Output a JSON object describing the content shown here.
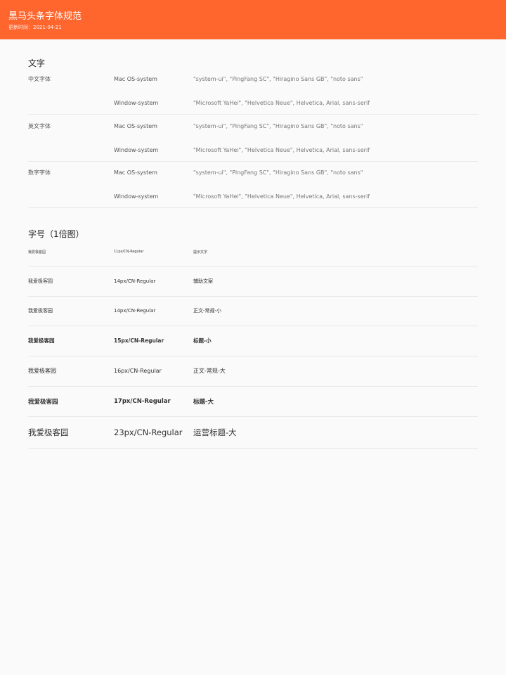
{
  "header": {
    "title": "黑马头条字体规范",
    "updated": "更新时间：2021-04-21"
  },
  "fonts_section": {
    "title": "文字",
    "groups": [
      {
        "label": "中文字体",
        "rows": [
          {
            "system": "Mac OS-system",
            "stack": "\"system-ui\", \"PingFang SC\", \"Hiragino Sans GB\", \"noto sans\""
          },
          {
            "system": "Window-system",
            "stack": "\"Microsoft YaHei\", \"Helvetica Neue\", Helvetica, Arial, sans-serif"
          }
        ]
      },
      {
        "label": "英文字体",
        "rows": [
          {
            "system": "Mac OS-system",
            "stack": "\"system-ui\", \"PingFang SC\", \"Hiragino Sans GB\", \"noto sans\""
          },
          {
            "system": "Window-system",
            "stack": "\"Microsoft YaHei\", \"Helvetica Neue\", Helvetica, Arial, sans-serif"
          }
        ]
      },
      {
        "label": "数字字体",
        "rows": [
          {
            "system": "Mac OS-system",
            "stack": "\"system-ui\", \"PingFang SC\", \"Hiragino Sans GB\", \"noto sans\""
          },
          {
            "system": "Window-system",
            "stack": "\"Microsoft YaHei\", \"Helvetica Neue\", Helvetica, Arial, sans-serif"
          }
        ]
      }
    ]
  },
  "sizes_section": {
    "title": "字号（1倍图）",
    "rows": [
      {
        "sample": "我爱极客园",
        "spec": "11px/CN-Regular",
        "usage": "提示文字"
      },
      {
        "sample": "我爱极客园",
        "spec": "14px/CN-Regular",
        "usage": "辅助文案"
      },
      {
        "sample": "我爱极客园",
        "spec": "14px/CN-Regular",
        "usage": "正文-常规-小"
      },
      {
        "sample": "我爱极客园",
        "spec": "15px/CN-Regular",
        "usage": "标题-小"
      },
      {
        "sample": "我爱极客园",
        "spec": "16px/CN-Regular",
        "usage": "正文-常规-大"
      },
      {
        "sample": "我爱极客园",
        "spec": "17px/CN-Regular",
        "usage": "标题-大"
      },
      {
        "sample": "我爱极客园",
        "spec": "23px/CN-Regular",
        "usage": "运营标题-大"
      }
    ]
  },
  "colors": {
    "header_bg": "#ff662e"
  }
}
